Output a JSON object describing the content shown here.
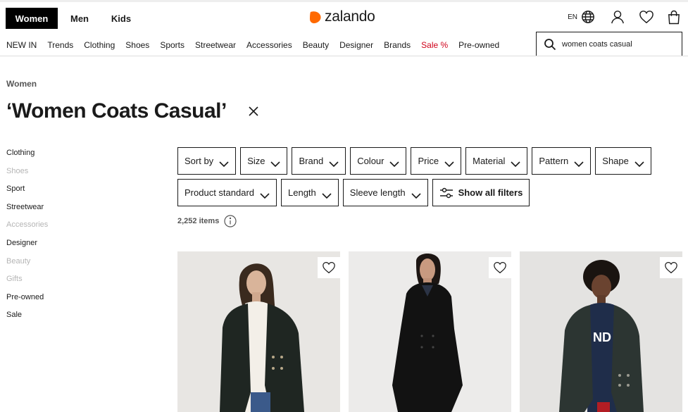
{
  "header": {
    "gender_tabs": [
      "Women",
      "Men",
      "Kids"
    ],
    "logo_text": "zalando",
    "language": "EN",
    "icons": [
      "globe-icon",
      "account-icon",
      "wishlist-icon",
      "bag-icon"
    ],
    "brand_color": "#ff6900"
  },
  "nav": {
    "items": [
      "NEW IN",
      "Trends",
      "Clothing",
      "Shoes",
      "Sports",
      "Streetwear",
      "Accessories",
      "Beauty",
      "Designer",
      "Brands",
      "Sale %",
      "Pre-owned"
    ],
    "sale_color": "#d0021b"
  },
  "search": {
    "value": "women coats casual"
  },
  "breadcrumb": "Women",
  "page_title": "‘Women Coats Casual’",
  "sidebar": {
    "items": [
      {
        "label": "Clothing",
        "enabled": true
      },
      {
        "label": "Shoes",
        "enabled": false
      },
      {
        "label": "Sport",
        "enabled": true
      },
      {
        "label": "Streetwear",
        "enabled": true
      },
      {
        "label": "Accessories",
        "enabled": false
      },
      {
        "label": "Designer",
        "enabled": true
      },
      {
        "label": "Beauty",
        "enabled": false
      },
      {
        "label": "Gifts",
        "enabled": false
      },
      {
        "label": "Pre-owned",
        "enabled": true
      },
      {
        "label": "Sale",
        "enabled": true
      }
    ]
  },
  "filters": {
    "row1": [
      "Sort by",
      "Size",
      "Brand",
      "Colour",
      "Price",
      "Material",
      "Pattern",
      "Shape"
    ],
    "row2": [
      "Product standard",
      "Length",
      "Sleeve length"
    ],
    "show_all": "Show all filters"
  },
  "items_count": "2,252 items",
  "products": [
    {
      "name": "product-card-1",
      "bg": "#e8e6e3",
      "coat_color": "#1f2622"
    },
    {
      "name": "product-card-2",
      "bg": "#ecebea",
      "coat_color": "#121212"
    },
    {
      "name": "product-card-3",
      "bg": "#e4e3e1",
      "coat_color": "#2c3532"
    }
  ]
}
